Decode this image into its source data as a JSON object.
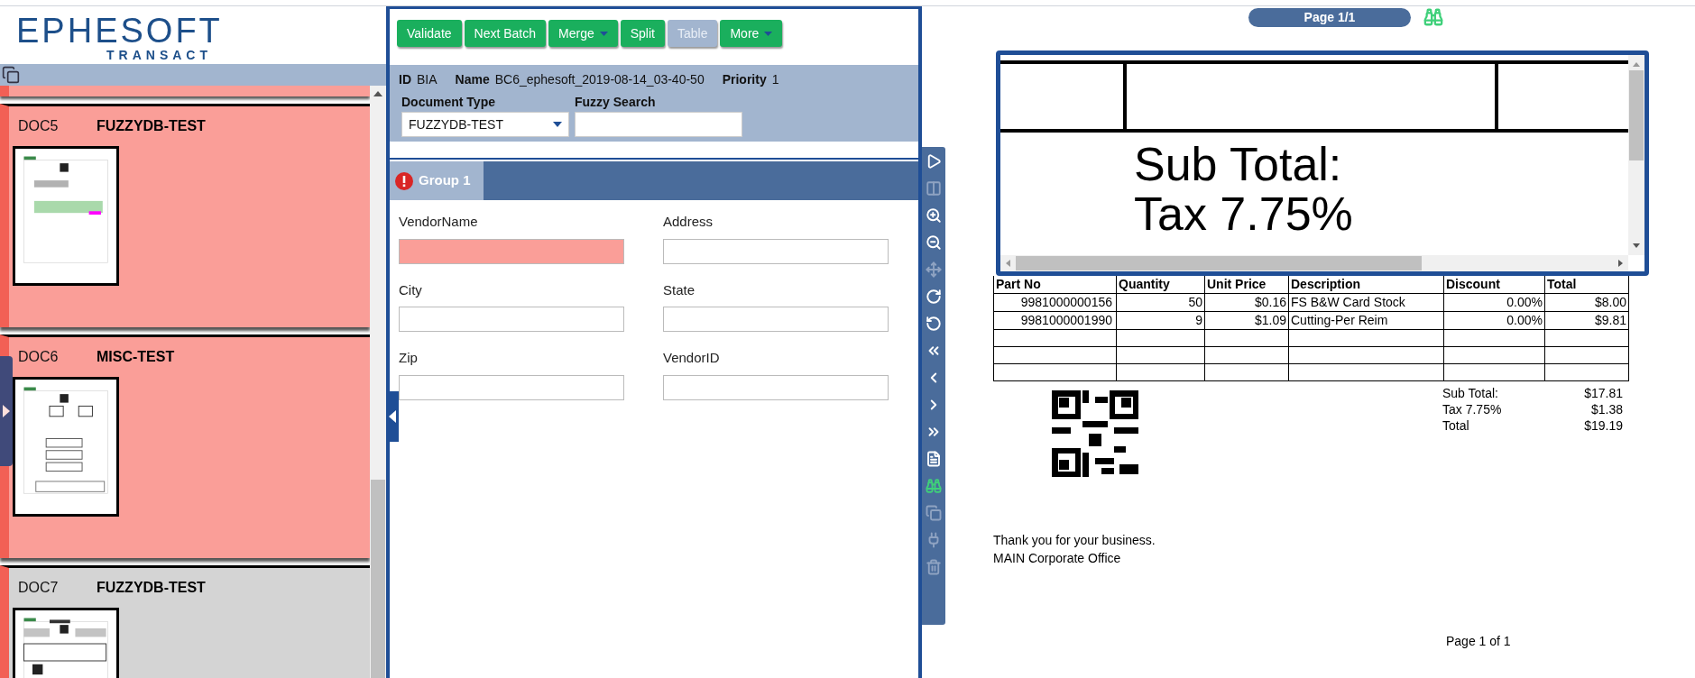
{
  "logo": {
    "word": "EPHESOFT",
    "sub": "TRANSACT"
  },
  "documents": [
    {
      "id": "DOC5",
      "type": "FUZZYDB-TEST",
      "error": true
    },
    {
      "id": "DOC6",
      "type": "MISC-TEST",
      "error": true
    },
    {
      "id": "DOC7",
      "type": "FUZZYDB-TEST",
      "error": false
    }
  ],
  "actions": [
    {
      "label": "Validate",
      "disabled": false,
      "menu": false
    },
    {
      "label": "Next Batch",
      "disabled": false,
      "menu": false
    },
    {
      "label": "Merge",
      "disabled": false,
      "menu": true
    },
    {
      "label": "Split",
      "disabled": false,
      "menu": false
    },
    {
      "label": "Table",
      "disabled": true,
      "menu": false
    },
    {
      "label": "More",
      "disabled": false,
      "menu": true
    }
  ],
  "batch": {
    "id_label": "ID",
    "id": "BIA",
    "name_label": "Name",
    "name": "BC6_ephesoft_2019-08-14_03-40-50",
    "priority_label": "Priority",
    "priority": "1"
  },
  "document_type": {
    "label": "Document Type",
    "value": "FUZZYDB-TEST"
  },
  "fuzzy_search": {
    "label": "Fuzzy Search"
  },
  "group": {
    "title": "Group 1",
    "error": true
  },
  "fields": [
    {
      "label": "VendorName",
      "error": true
    },
    {
      "label": "Address",
      "error": false
    },
    {
      "label": "City",
      "error": false
    },
    {
      "label": "State",
      "error": false
    },
    {
      "label": "Zip",
      "error": false
    },
    {
      "label": "VendorID",
      "error": false
    }
  ],
  "toolbar": [
    {
      "kind": "play",
      "disabled": false
    },
    {
      "kind": "columns",
      "disabled": true
    },
    {
      "kind": "zoom-in",
      "disabled": false
    },
    {
      "kind": "zoom-out",
      "disabled": false
    },
    {
      "kind": "move",
      "disabled": true
    },
    {
      "kind": "rotate-right",
      "disabled": false
    },
    {
      "kind": "rotate-left",
      "disabled": false
    },
    {
      "kind": "first",
      "disabled": false
    },
    {
      "kind": "previous",
      "disabled": false
    },
    {
      "kind": "next",
      "disabled": false
    },
    {
      "kind": "last",
      "disabled": false
    },
    {
      "kind": "document",
      "disabled": false
    },
    {
      "kind": "find",
      "disabled": false
    },
    {
      "kind": "copy",
      "disabled": true
    },
    {
      "kind": "plug",
      "disabled": true
    },
    {
      "kind": "delete",
      "disabled": true
    }
  ],
  "viewer": {
    "page": "Page 1/1",
    "zoom_lines": [
      "Sub Total:",
      "Tax 7.75%"
    ],
    "table": {
      "columns": [
        "Part No",
        "Quantity",
        "Unit Price",
        "Description",
        "Discount",
        "Total"
      ],
      "rows": [
        [
          "9981000000156",
          "50",
          "$0.16",
          "FS B&W Card Stock",
          "0.00%",
          "$8.00"
        ],
        [
          "9981000001990",
          "9",
          "$1.09",
          "Cutting-Per Reim",
          "0.00%",
          "$9.81"
        ]
      ]
    },
    "totals": [
      {
        "label": "Sub Total:",
        "value": "$17.81"
      },
      {
        "label": "Tax 7.75%",
        "value": "$1.38"
      },
      {
        "label": "Total",
        "value": "$19.19"
      }
    ],
    "footer_lines": [
      "Thank you for your business.",
      "MAIN Corporate Office"
    ],
    "page_footer": "Page 1 of 1"
  }
}
